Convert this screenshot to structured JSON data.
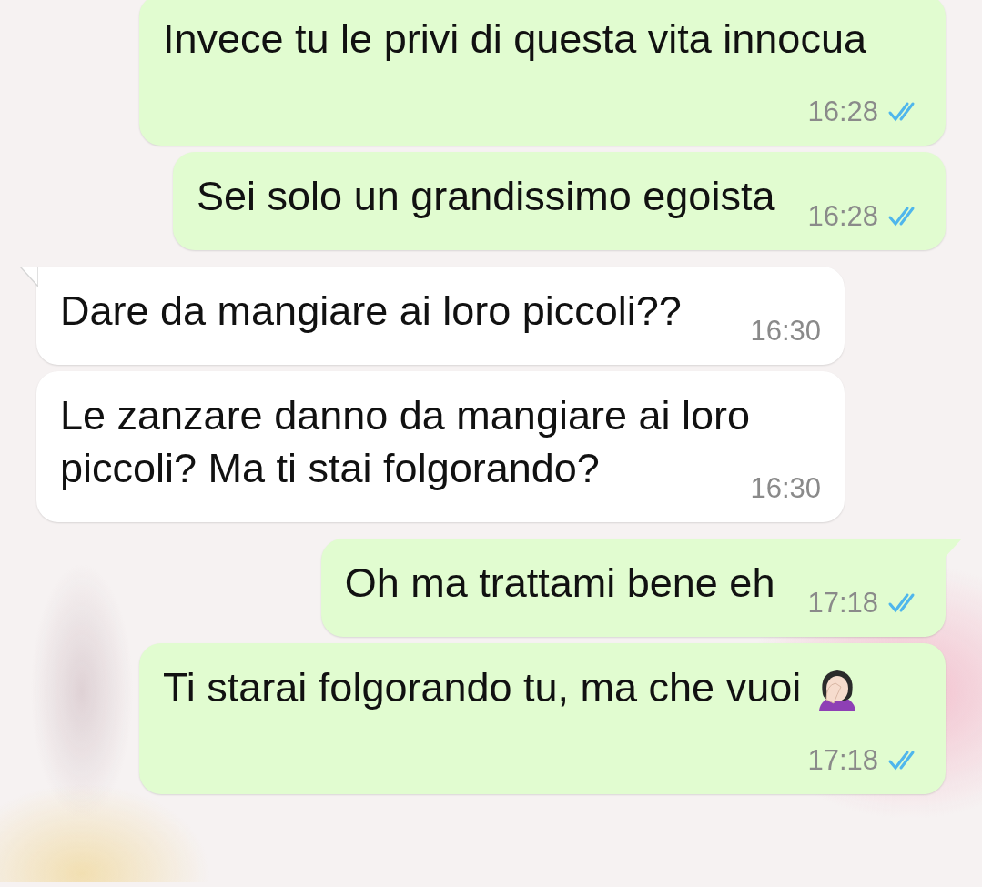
{
  "messages": [
    {
      "kind": "sent",
      "text": "Invece tu le privi di questa vita innocua",
      "time": "16:28",
      "read": true,
      "tail": false,
      "emoji": false
    },
    {
      "kind": "sent",
      "text": "Sei solo un grandissimo egoista",
      "time": "16:28",
      "read": true,
      "tail": false,
      "emoji": false
    },
    {
      "kind": "received",
      "text": "Dare da mangiare ai loro piccoli??",
      "time": "16:30",
      "tail": true,
      "emoji": false
    },
    {
      "kind": "received",
      "text": "Le zanzare danno da mangiare ai loro piccoli? Ma ti stai folgorando?",
      "time": "16:30",
      "tail": false,
      "emoji": false
    },
    {
      "kind": "sent",
      "text": "Oh ma trattami bene eh",
      "time": "17:18",
      "read": true,
      "tail": true,
      "emoji": false
    },
    {
      "kind": "sent",
      "text": "Ti starai folgorando tu, ma che vuoi",
      "time": "17:18",
      "read": true,
      "tail": false,
      "emoji": true
    }
  ]
}
